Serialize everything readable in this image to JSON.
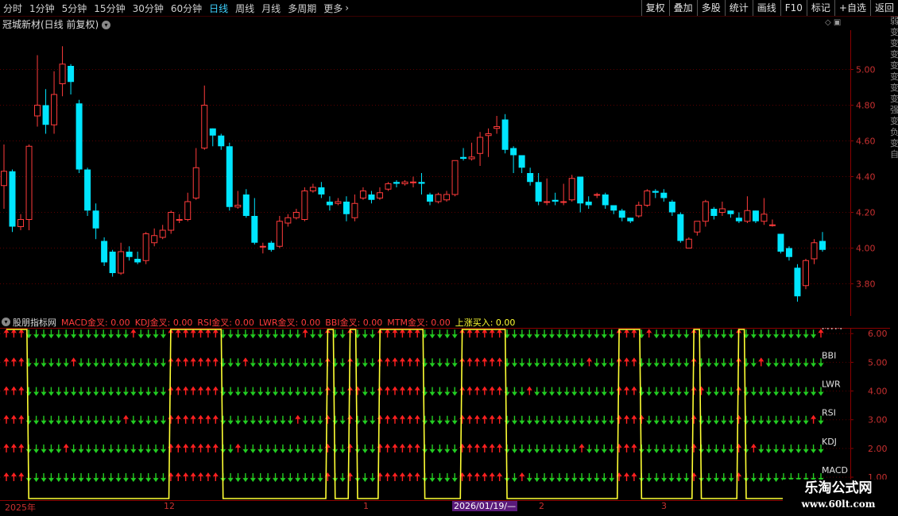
{
  "toolbar": {
    "periods": [
      "分时",
      "1分钟",
      "5分钟",
      "15分钟",
      "30分钟",
      "60分钟",
      "日线",
      "周线",
      "月线",
      "多周期",
      "更多"
    ],
    "active_period": "日线",
    "more_icon": "chevron-right-icon",
    "right_buttons": [
      "复权",
      "叠加",
      "多股",
      "统计",
      "画线",
      "F10",
      "标记",
      "+自选",
      "返回"
    ]
  },
  "main": {
    "title": "冠城新材(日线 前复权)",
    "title_icon": "chevron-down-icon",
    "right_strip_text": "弱变变变变变变变强变负变自"
  },
  "colors": {
    "up": "#ff3b3b",
    "down": "#00e5ff",
    "grid": "#5a0000",
    "axis": "#8b0000",
    "axis_label": "#c83030",
    "ind_line": "#ffff33",
    "arrow_up": "#ff2020",
    "arrow_down": "#22cc22"
  },
  "chart_data": [
    {
      "type": "candlestick",
      "title": "冠城新材(日线 前复权)",
      "y_ticks": [
        3.8,
        4.0,
        4.2,
        4.4,
        4.6,
        4.8,
        5.0
      ],
      "ylim": [
        3.62,
        5.22
      ],
      "candles": [
        [
          4.35,
          4.43,
          4.58,
          4.22
        ],
        [
          4.43,
          4.12,
          4.44,
          4.09
        ],
        [
          4.12,
          4.16,
          4.19,
          4.1
        ],
        [
          4.16,
          4.57,
          4.58,
          4.1
        ],
        [
          4.74,
          4.8,
          5.08,
          4.68
        ],
        [
          4.8,
          4.69,
          4.89,
          4.64
        ],
        [
          4.69,
          4.86,
          4.99,
          4.64
        ],
        [
          4.92,
          5.03,
          5.13,
          4.85
        ],
        [
          5.02,
          4.93,
          5.03,
          4.86
        ],
        [
          4.81,
          4.44,
          4.83,
          4.42
        ],
        [
          4.44,
          4.21,
          4.45,
          4.18
        ],
        [
          4.21,
          4.11,
          4.25,
          4.05
        ],
        [
          4.04,
          3.92,
          4.06,
          3.9
        ],
        [
          3.98,
          3.86,
          3.99,
          3.84
        ],
        [
          3.86,
          3.98,
          4.03,
          3.85
        ],
        [
          3.98,
          3.95,
          4.01,
          3.93
        ],
        [
          3.94,
          3.92,
          3.98,
          3.91
        ],
        [
          3.93,
          4.08,
          4.09,
          3.91
        ],
        [
          4.03,
          4.07,
          4.11,
          4.01
        ],
        [
          4.06,
          4.1,
          4.13,
          4.05
        ],
        [
          4.1,
          4.2,
          4.21,
          4.08
        ],
        [
          4.16,
          4.16,
          4.19,
          4.14
        ],
        [
          4.16,
          4.26,
          4.31,
          4.15
        ],
        [
          4.28,
          4.45,
          4.56,
          4.27
        ],
        [
          4.56,
          4.8,
          4.91,
          4.55
        ],
        [
          4.67,
          4.63,
          4.67,
          4.57
        ],
        [
          4.63,
          4.57,
          4.64,
          4.55
        ],
        [
          4.57,
          4.23,
          4.59,
          4.21
        ],
        [
          4.23,
          4.24,
          4.32,
          4.22
        ],
        [
          4.3,
          4.18,
          4.33,
          4.17
        ],
        [
          4.18,
          4.03,
          4.28,
          4.02
        ],
        [
          4.01,
          4.01,
          4.03,
          3.97
        ],
        [
          4.03,
          3.99,
          4.04,
          3.98
        ],
        [
          4.01,
          4.15,
          4.18,
          4.0
        ],
        [
          4.14,
          4.17,
          4.19,
          4.12
        ],
        [
          4.17,
          4.2,
          4.22,
          4.16
        ],
        [
          4.16,
          4.32,
          4.34,
          4.15
        ],
        [
          4.32,
          4.34,
          4.36,
          4.31
        ],
        [
          4.34,
          4.3,
          4.37,
          4.28
        ],
        [
          4.26,
          4.24,
          4.29,
          4.21
        ],
        [
          4.25,
          4.26,
          4.28,
          4.24
        ],
        [
          4.26,
          4.19,
          4.29,
          4.15
        ],
        [
          4.17,
          4.25,
          4.3,
          4.15
        ],
        [
          4.28,
          4.32,
          4.34,
          4.27
        ],
        [
          4.3,
          4.27,
          4.32,
          4.25
        ],
        [
          4.28,
          4.31,
          4.34,
          4.27
        ],
        [
          4.33,
          4.36,
          4.37,
          4.32
        ],
        [
          4.37,
          4.36,
          4.38,
          4.34
        ],
        [
          4.36,
          4.37,
          4.38,
          4.35
        ],
        [
          4.37,
          4.37,
          4.4,
          4.34
        ],
        [
          4.37,
          4.36,
          4.42,
          4.3
        ],
        [
          4.3,
          4.26,
          4.31,
          4.24
        ],
        [
          4.26,
          4.3,
          4.31,
          4.25
        ],
        [
          4.27,
          4.3,
          4.32,
          4.26
        ],
        [
          4.3,
          4.49,
          4.49,
          4.29
        ],
        [
          4.51,
          4.5,
          4.56,
          4.49
        ],
        [
          4.5,
          4.51,
          4.59,
          4.49
        ],
        [
          4.53,
          4.62,
          4.65,
          4.46
        ],
        [
          4.63,
          4.64,
          4.67,
          4.51
        ],
        [
          4.67,
          4.68,
          4.74,
          4.64
        ],
        [
          4.72,
          4.55,
          4.75,
          4.53
        ],
        [
          4.56,
          4.52,
          4.57,
          4.42
        ],
        [
          4.52,
          4.45,
          4.52,
          4.42
        ],
        [
          4.42,
          4.37,
          4.45,
          4.35
        ],
        [
          4.37,
          4.26,
          4.42,
          4.24
        ],
        [
          4.26,
          4.26,
          4.39,
          4.24
        ],
        [
          4.27,
          4.26,
          4.31,
          4.24
        ],
        [
          4.26,
          4.26,
          4.36,
          4.24
        ],
        [
          4.27,
          4.39,
          4.41,
          4.26
        ],
        [
          4.4,
          4.25,
          4.4,
          4.2
        ],
        [
          4.26,
          4.24,
          4.29,
          4.22
        ],
        [
          4.3,
          4.3,
          4.31,
          4.28
        ],
        [
          4.3,
          4.24,
          4.31,
          4.22
        ],
        [
          4.24,
          4.21,
          4.24,
          4.19
        ],
        [
          4.21,
          4.17,
          4.22,
          4.15
        ],
        [
          4.17,
          4.15,
          4.17,
          4.14
        ],
        [
          4.18,
          4.24,
          4.26,
          4.17
        ],
        [
          4.24,
          4.32,
          4.33,
          4.23
        ],
        [
          4.32,
          4.31,
          4.33,
          4.28
        ],
        [
          4.31,
          4.28,
          4.33,
          4.26
        ],
        [
          4.26,
          4.2,
          4.27,
          4.18
        ],
        [
          4.19,
          4.04,
          4.2,
          4.03
        ],
        [
          4.0,
          4.05,
          4.06,
          4.0
        ],
        [
          4.09,
          4.15,
          4.15,
          4.07
        ],
        [
          4.15,
          4.26,
          4.27,
          4.12
        ],
        [
          4.22,
          4.18,
          4.23,
          4.16
        ],
        [
          4.2,
          4.22,
          4.26,
          4.18
        ],
        [
          4.21,
          4.19,
          4.21,
          4.17
        ],
        [
          4.17,
          4.15,
          4.2,
          4.14
        ],
        [
          4.15,
          4.21,
          4.29,
          4.14
        ],
        [
          4.21,
          4.15,
          4.21,
          4.14
        ],
        [
          4.15,
          4.19,
          4.28,
          4.13
        ],
        [
          4.13,
          4.13,
          4.16,
          4.12
        ],
        [
          4.08,
          3.98,
          4.08,
          3.97
        ],
        [
          4.0,
          3.95,
          4.01,
          3.93
        ],
        [
          3.89,
          3.73,
          3.91,
          3.7
        ],
        [
          3.79,
          3.93,
          3.94,
          3.77
        ],
        [
          3.94,
          4.03,
          4.05,
          3.91
        ],
        [
          4.04,
          3.99,
          4.09,
          3.98
        ]
      ]
    },
    {
      "type": "line",
      "title": "股朋指标网",
      "y_ticks": [
        1.0,
        2.0,
        3.0,
        4.0,
        5.0,
        6.0
      ],
      "ylim": [
        0.2,
        6.2
      ],
      "series": [
        {
          "name": "MACD金叉",
          "value": "0.00"
        },
        {
          "name": "KDJ金叉",
          "value": "0.00"
        },
        {
          "name": "RSI金叉",
          "value": "0.00"
        },
        {
          "name": "LWR金叉",
          "value": "0.00"
        },
        {
          "name": "BBI金叉",
          "value": "0.00"
        },
        {
          "name": "MTM金叉",
          "value": "0.00"
        },
        {
          "name": "上涨买入",
          "value": "0.00"
        }
      ],
      "row_labels": [
        "MACD",
        "KDJ",
        "RSI",
        "LWR",
        "BBI",
        "MTM"
      ],
      "rise_buy": [
        1,
        1,
        1,
        0,
        0,
        0,
        0,
        0,
        0,
        0,
        0,
        0,
        0,
        0,
        0,
        0,
        0,
        0,
        0,
        0,
        0,
        0,
        1,
        1,
        1,
        1,
        1,
        1,
        1,
        0,
        0,
        0,
        0,
        0,
        0,
        0,
        0,
        0,
        0,
        0,
        0,
        0,
        0,
        1,
        0,
        0,
        1,
        0,
        0,
        0,
        1,
        1,
        1,
        1,
        1,
        1,
        0,
        0,
        0,
        0,
        0,
        1,
        1,
        1,
        1,
        1,
        1,
        0,
        0,
        0,
        0,
        0,
        0,
        0,
        0,
        0,
        0,
        0,
        0,
        0,
        0,
        0,
        1,
        1,
        1,
        0,
        0,
        0,
        0,
        0,
        0,
        0,
        1,
        0,
        0,
        0,
        0,
        0,
        1,
        0,
        0,
        0,
        0,
        0,
        0,
        0,
        0,
        0,
        0,
        0
      ]
    }
  ],
  "x_axis": {
    "labels": [
      {
        "text": "2025年"
      },
      {
        "text": "12"
      },
      {
        "text": "1"
      },
      {
        "text": "2"
      },
      {
        "text": "3"
      }
    ],
    "cursor_label": "2026/01/19/—"
  },
  "watermark": {
    "title": "乐淘公式网",
    "url": "www.60lt.com"
  }
}
